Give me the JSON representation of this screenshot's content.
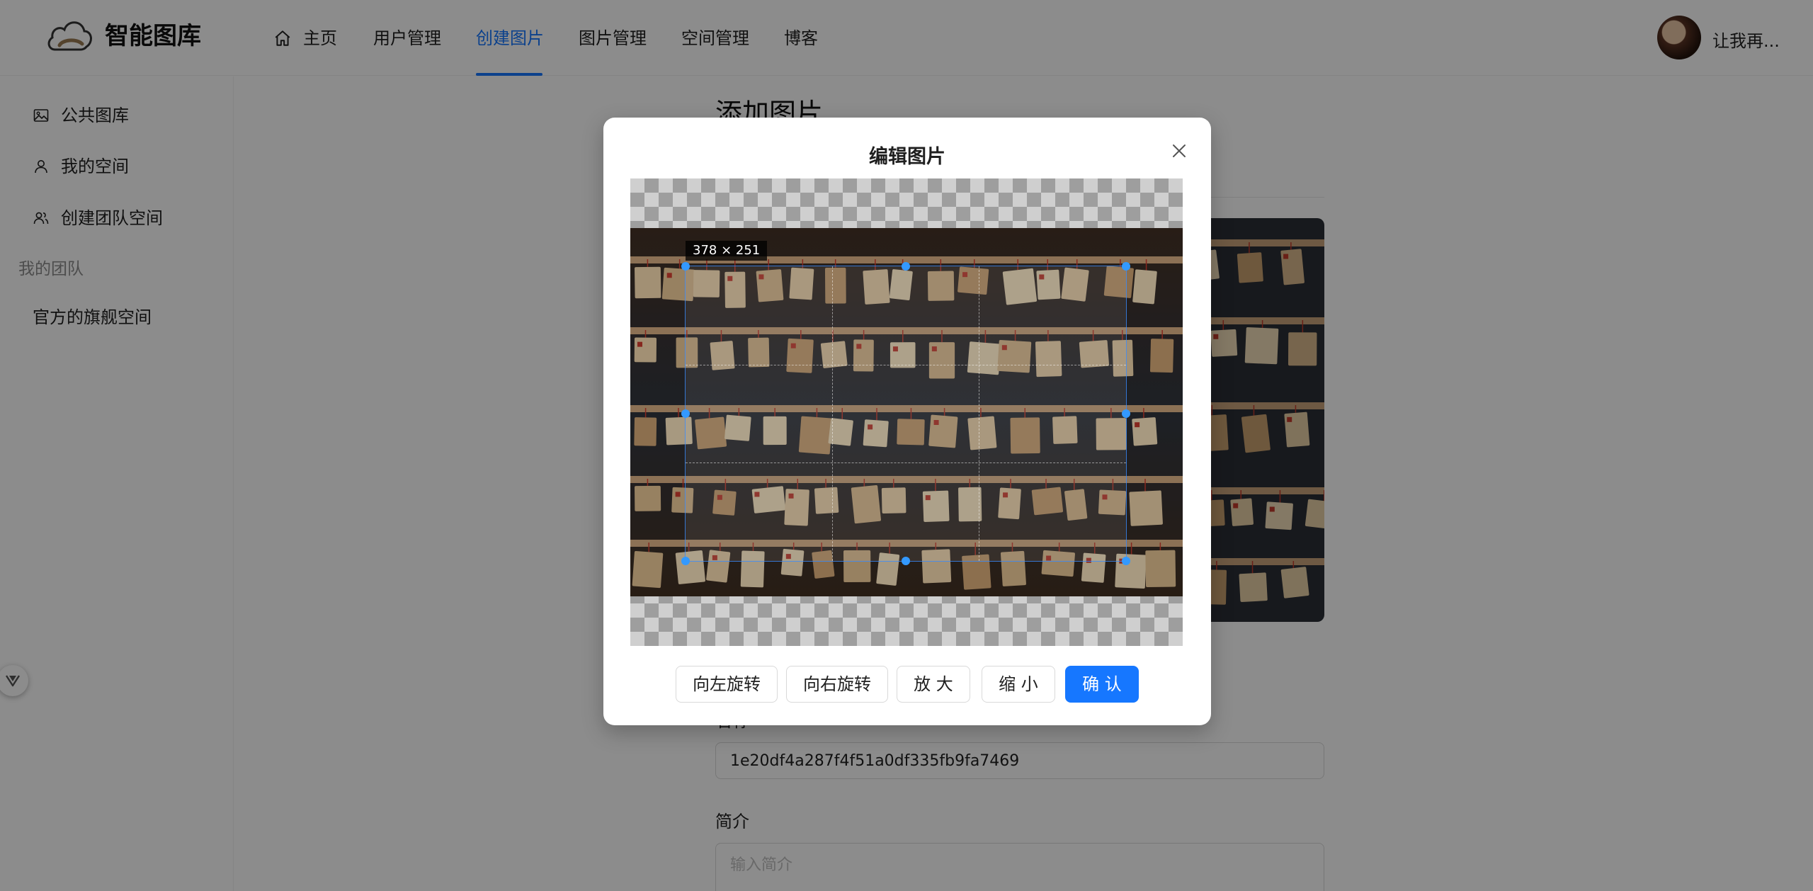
{
  "header": {
    "app_title": "智能图库",
    "logo_icon": "cloud-icon",
    "nav": [
      {
        "label": "主页",
        "icon": "home-icon"
      },
      {
        "label": "用户管理"
      },
      {
        "label": "创建图片",
        "active": true
      },
      {
        "label": "图片管理"
      },
      {
        "label": "空间管理"
      },
      {
        "label": "博客"
      }
    ],
    "user_name": "让我再..."
  },
  "sidebar": {
    "items": [
      {
        "label": "公共图库",
        "icon": "picture-icon"
      },
      {
        "label": "我的空间",
        "icon": "user-icon"
      },
      {
        "label": "创建团队空间",
        "icon": "team-icon"
      }
    ],
    "group_title": "我的团队",
    "team_items": [
      {
        "label": "官方的旗舰空间"
      }
    ]
  },
  "main": {
    "heading": "添加图片",
    "name_label": "名称",
    "name_value": "1e20df4a287f4f51a0df335fb9fa7469",
    "intro_label": "简介",
    "intro_placeholder": "输入简介"
  },
  "modal": {
    "title": "编辑图片",
    "crop_size": "378 × 251",
    "buttons": {
      "rotate_left": "向左旋转",
      "rotate_right": "向右旋转",
      "zoom_in": "放 大",
      "zoom_out": "缩 小",
      "confirm": "确 认"
    }
  },
  "colors": {
    "accent": "#1677ff",
    "mask": "rgba(0,0,0,0.45)",
    "crop_handle": "#3399ff"
  }
}
